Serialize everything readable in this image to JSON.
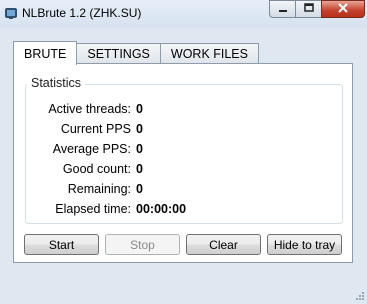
{
  "window": {
    "title": "NLBrute 1.2 (ZHK.SU)",
    "close_color": "#c4402a",
    "icons": [
      "app-logo-icon",
      "minimize-icon",
      "maximize-icon",
      "close-icon"
    ]
  },
  "tabs": [
    {
      "label": "BRUTE",
      "active": true
    },
    {
      "label": "SETTINGS",
      "active": false
    },
    {
      "label": "WORK FILES",
      "active": false
    }
  ],
  "statistics": {
    "title": "Statistics",
    "rows": [
      {
        "label": "Active threads:",
        "value": "0"
      },
      {
        "label": "Current PPS",
        "value": "0"
      },
      {
        "label": "Average PPS:",
        "value": "0"
      },
      {
        "label": "Good count:",
        "value": "0"
      },
      {
        "label": "Remaining:",
        "value": "0"
      },
      {
        "label": "Elapsed time:",
        "value": "00:00:00"
      }
    ]
  },
  "buttons": {
    "start": "Start",
    "stop": "Stop",
    "clear": "Clear",
    "hide": "Hide to tray"
  }
}
